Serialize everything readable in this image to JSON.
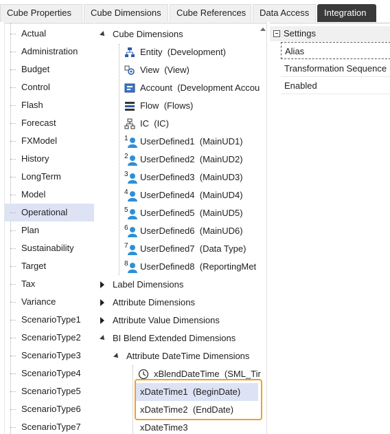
{
  "tabs": [
    {
      "label": "Cube Properties"
    },
    {
      "label": "Cube Dimensions"
    },
    {
      "label": "Cube References"
    },
    {
      "label": "Data Access"
    },
    {
      "label": "Integration"
    }
  ],
  "left_list": {
    "selected": "Operational",
    "items": [
      "Actual",
      "Administration",
      "Budget",
      "Control",
      "Flash",
      "Forecast",
      "FXModel",
      "History",
      "LongTerm",
      "Model",
      "Operational",
      "Plan",
      "Sustainability",
      "Target",
      "Tax",
      "Variance",
      "ScenarioType1",
      "ScenarioType2",
      "ScenarioType3",
      "ScenarioType4",
      "ScenarioType5",
      "ScenarioType6",
      "ScenarioType7"
    ]
  },
  "tree": {
    "cube_dimensions": "Cube Dimensions",
    "dims": [
      {
        "name": "Entity",
        "detail": "(Development)",
        "icon": "entity-hierarchy-icon"
      },
      {
        "name": "View",
        "detail": "(View)",
        "icon": "view-icon"
      },
      {
        "name": "Account",
        "detail": "(Development Accou",
        "icon": "account-icon"
      },
      {
        "name": "Flow",
        "detail": "(Flows)",
        "icon": "flow-icon"
      },
      {
        "name": "IC",
        "detail": "(IC)",
        "icon": "ic-hierarchy-icon"
      },
      {
        "name": "UserDefined1",
        "detail": "(MainUD1)",
        "num": "1"
      },
      {
        "name": "UserDefined2",
        "detail": "(MainUD2)",
        "num": "2"
      },
      {
        "name": "UserDefined3",
        "detail": "(MainUD3)",
        "num": "3"
      },
      {
        "name": "UserDefined4",
        "detail": "(MainUD4)",
        "num": "4"
      },
      {
        "name": "UserDefined5",
        "detail": "(MainUD5)",
        "num": "5"
      },
      {
        "name": "UserDefined6",
        "detail": "(MainUD6)",
        "num": "6"
      },
      {
        "name": "UserDefined7",
        "detail": "(Data Type)",
        "num": "7"
      },
      {
        "name": "UserDefined8",
        "detail": "(ReportingMet",
        "num": "8"
      }
    ],
    "label_dimensions": "Label Dimensions",
    "attribute_dimensions": "Attribute Dimensions",
    "attribute_value_dimensions": "Attribute Value Dimensions",
    "bi_blend": "BI Blend Extended Dimensions",
    "attr_datetime": "Attribute DateTime Dimensions",
    "xblend": {
      "name": "xBlendDateTime",
      "detail": "(SML_Tir"
    },
    "xdt1": {
      "name": "xDateTime1",
      "detail": "(BeginDate)"
    },
    "xdt2": {
      "name": "xDateTime2",
      "detail": "(EndDate)"
    },
    "xdt3": {
      "name": "xDateTime3",
      "detail": ""
    }
  },
  "settings": {
    "header": "Settings",
    "rows": [
      "Alias",
      "Transformation Sequence",
      "Enabled"
    ]
  },
  "colors": {
    "accent": "#f2a01f",
    "selected": "#dde3f5",
    "active_tab": "#3a3a3a",
    "user_icon": "#2f8fd6"
  }
}
